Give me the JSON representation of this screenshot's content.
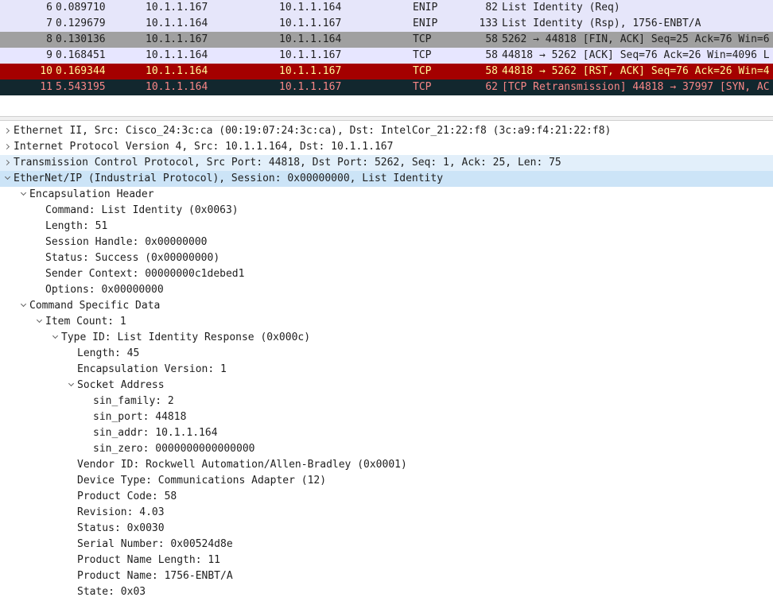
{
  "packets": [
    {
      "no": "6",
      "time": "0.089710",
      "src": "10.1.1.167",
      "dst": "10.1.1.164",
      "proto": "ENIP",
      "len": "82",
      "info": "List Identity (Req)"
    },
    {
      "no": "7",
      "time": "0.129679",
      "src": "10.1.1.164",
      "dst": "10.1.1.167",
      "proto": "ENIP",
      "len": "133",
      "info": "List Identity (Rsp), 1756-ENBT/A"
    },
    {
      "no": "8",
      "time": "0.130136",
      "src": "10.1.1.167",
      "dst": "10.1.1.164",
      "proto": "TCP",
      "len": "58",
      "info": "5262 → 44818 [FIN, ACK] Seq=25 Ack=76 Win=6"
    },
    {
      "no": "9",
      "time": "0.168451",
      "src": "10.1.1.164",
      "dst": "10.1.1.167",
      "proto": "TCP",
      "len": "58",
      "info": "44818 → 5262 [ACK] Seq=76 Ack=26 Win=4096 L"
    },
    {
      "no": "10",
      "time": "0.169344",
      "src": "10.1.1.164",
      "dst": "10.1.1.167",
      "proto": "TCP",
      "len": "58",
      "info": "44818 → 5262 [RST, ACK] Seq=76 Ack=26 Win=4"
    },
    {
      "no": "11",
      "time": "5.543195",
      "src": "10.1.1.164",
      "dst": "10.1.1.167",
      "proto": "TCP",
      "len": "62",
      "info": "[TCP Retransmission] 44818 → 37997 [SYN, AC"
    }
  ],
  "colors": {
    "enip_row": "#e6e6fa",
    "fin_row": "#a0a0a0",
    "rst_row": "#a40000",
    "rst_text": "#fffc9c",
    "retx_row": "#12272e",
    "retx_text": "#f78787",
    "selected_detail": "#cce4f7"
  },
  "details": [
    {
      "text": "Ethernet II, Src: Cisco_24:3c:ca (00:19:07:24:3c:ca), Dst: IntelCor_21:22:f8 (3c:a9:f4:21:22:f8)",
      "state": "collapsed",
      "depth": 0
    },
    {
      "text": "Internet Protocol Version 4, Src: 10.1.1.164, Dst: 10.1.1.167",
      "state": "collapsed",
      "depth": 0
    },
    {
      "text": "Transmission Control Protocol, Src Port: 44818, Dst Port: 5262, Seq: 1, Ack: 25, Len: 75",
      "state": "collapsed",
      "depth": 0,
      "highlight": "light"
    },
    {
      "text": "EtherNet/IP (Industrial Protocol), Session: 0x00000000, List Identity",
      "state": "expanded",
      "depth": 0,
      "highlight": "selected"
    },
    {
      "text": "Encapsulation Header",
      "state": "expanded",
      "depth": 1
    },
    {
      "text": "Command: List Identity (0x0063)",
      "state": "leaf",
      "depth": 2
    },
    {
      "text": "Length: 51",
      "state": "leaf",
      "depth": 2
    },
    {
      "text": "Session Handle: 0x00000000",
      "state": "leaf",
      "depth": 2
    },
    {
      "text": "Status: Success (0x00000000)",
      "state": "leaf",
      "depth": 2
    },
    {
      "text": "Sender Context: 00000000c1debed1",
      "state": "leaf",
      "depth": 2
    },
    {
      "text": "Options: 0x00000000",
      "state": "leaf",
      "depth": 2
    },
    {
      "text": "Command Specific Data",
      "state": "expanded",
      "depth": 1
    },
    {
      "text": "Item Count: 1",
      "state": "expanded",
      "depth": 2
    },
    {
      "text": "Type ID: List Identity Response (0x000c)",
      "state": "expanded",
      "depth": 3
    },
    {
      "text": "Length: 45",
      "state": "leaf",
      "depth": 4
    },
    {
      "text": "Encapsulation Version: 1",
      "state": "leaf",
      "depth": 4
    },
    {
      "text": "Socket Address",
      "state": "expanded",
      "depth": 4
    },
    {
      "text": "sin_family: 2",
      "state": "leaf",
      "depth": 5
    },
    {
      "text": "sin_port: 44818",
      "state": "leaf",
      "depth": 5
    },
    {
      "text": "sin_addr: 10.1.1.164",
      "state": "leaf",
      "depth": 5
    },
    {
      "text": "sin_zero: 0000000000000000",
      "state": "leaf",
      "depth": 5
    },
    {
      "text": "Vendor ID: Rockwell Automation/Allen-Bradley (0x0001)",
      "state": "leaf",
      "depth": 4
    },
    {
      "text": "Device Type: Communications Adapter (12)",
      "state": "leaf",
      "depth": 4
    },
    {
      "text": "Product Code: 58",
      "state": "leaf",
      "depth": 4
    },
    {
      "text": "Revision: 4.03",
      "state": "leaf",
      "depth": 4
    },
    {
      "text": "Status: 0x0030",
      "state": "leaf",
      "depth": 4
    },
    {
      "text": "Serial Number: 0x00524d8e",
      "state": "leaf",
      "depth": 4
    },
    {
      "text": "Product Name Length: 11",
      "state": "leaf",
      "depth": 4
    },
    {
      "text": "Product Name: 1756-ENBT/A",
      "state": "leaf",
      "depth": 4
    },
    {
      "text": "State: 0x03",
      "state": "leaf",
      "depth": 4
    }
  ]
}
